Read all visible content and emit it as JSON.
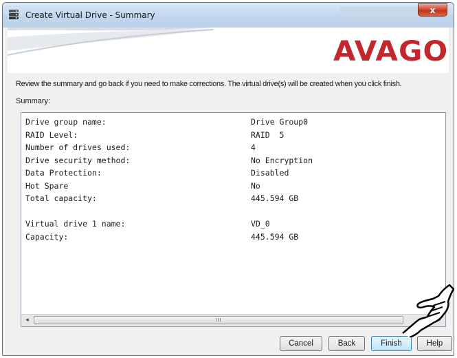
{
  "window": {
    "title": "Create Virtual Drive - Summary",
    "close_label": "x"
  },
  "brand": {
    "logo_text": "AVAGO",
    "logo_color": "#c4262e"
  },
  "instruction": "Review the summary and go back if you need to make corrections. The virtual drive(s) will be created when you click finish.",
  "summary_label": "Summary:",
  "summary": {
    "rows": [
      {
        "key": "Drive group name:",
        "value": "Drive Group0"
      },
      {
        "key": "RAID Level:",
        "value": "RAID  5"
      },
      {
        "key": "Number of drives used:",
        "value": "4"
      },
      {
        "key": "Drive security method:",
        "value": "No Encryption"
      },
      {
        "key": "Data Protection:",
        "value": "Disabled"
      },
      {
        "key": "Hot Spare",
        "value": "No"
      },
      {
        "key": "Total capacity:",
        "value": "445.594 GB"
      }
    ],
    "vd_rows": [
      {
        "key": "Virtual drive 1 name:",
        "value": "VD_0"
      },
      {
        "key": "Capacity:",
        "value": "445.594 GB"
      }
    ],
    "scroll_left": "◂",
    "scroll_right": "▸",
    "scroll_grip": "III"
  },
  "buttons": {
    "cancel": "Cancel",
    "back": "Back",
    "finish": "Finish",
    "help": "Help"
  },
  "icons": {
    "app": "drive-stack-icon",
    "pointer": "pointing-hand-icon"
  }
}
